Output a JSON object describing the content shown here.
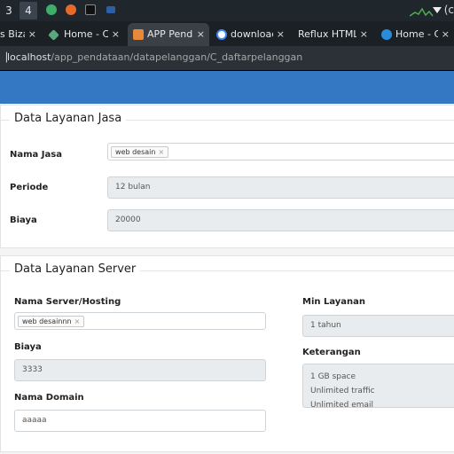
{
  "system": {
    "workspaces": [
      "3",
      "4"
    ],
    "tray_text": "(c"
  },
  "tabs": [
    {
      "label": "s Bizarr",
      "close": "×"
    },
    {
      "label": "Home - Cybe",
      "close": "×"
    },
    {
      "label": "APP Pendata",
      "close": "×"
    },
    {
      "label": "download fr",
      "close": "×"
    },
    {
      "label": "Reflux HTML CS",
      "close": "×"
    },
    {
      "label": "Home - Canv",
      "close": "×"
    }
  ],
  "address": {
    "host": "localhost",
    "path": "/app_pendataan/datapelanggan/C_daftarpelanggan"
  },
  "jasa": {
    "legend": "Data Layanan Jasa",
    "nama_label": "Nama Jasa",
    "nama_tag": "web desain",
    "periode_label": "Periode",
    "periode_value": "12 bulan",
    "biaya_label": "Biaya",
    "biaya_value": "20000"
  },
  "server": {
    "legend": "Data Layanan Server",
    "nama_label": "Nama Server/Hosting",
    "nama_tag": "web desainnn",
    "biaya_label": "Biaya",
    "biaya_value": "3333",
    "domain_label": "Nama Domain",
    "domain_value": "aaaaa",
    "min_label": "Min Layanan",
    "min_value": "1 tahun",
    "ket_label": "Keterangan",
    "ket_lines": [
      "1 GB space",
      "Unlimited traffic",
      "Unlimited email"
    ]
  },
  "tag_remove": "×",
  "colors": {
    "header": "#3478c4",
    "browser_bg": "#1b2024"
  }
}
